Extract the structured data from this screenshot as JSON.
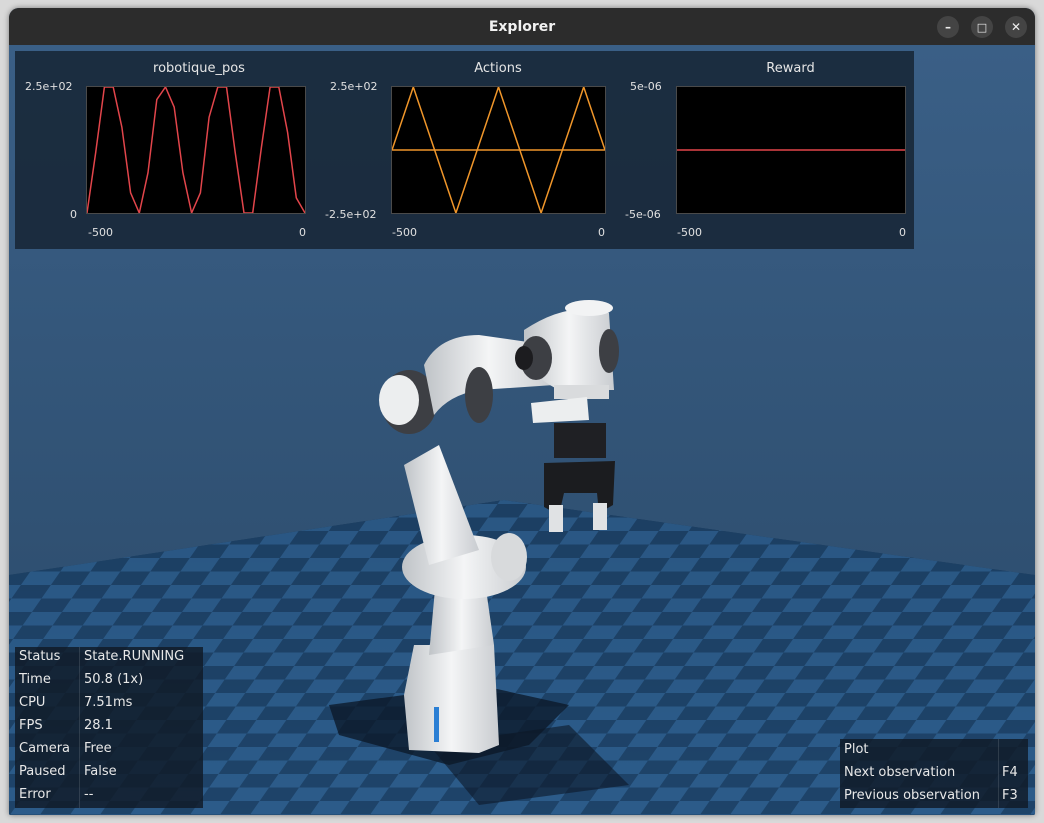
{
  "window": {
    "title": "Explorer",
    "minimize_glyph": "–",
    "maximize_glyph": "□",
    "close_glyph": "✕"
  },
  "plots": [
    {
      "title": "robotique_pos",
      "y_top": "2.5e+02",
      "y_bottom": "0",
      "x_left": "-500",
      "x_right": "0",
      "color": "#e2454b"
    },
    {
      "title": "Actions",
      "y_top": "2.5e+02",
      "y_bottom": "-2.5e+02",
      "x_left": "-500",
      "x_right": "0",
      "color": "#f0962a"
    },
    {
      "title": "Reward",
      "y_top": "5e-06",
      "y_bottom": "-5e-06",
      "x_left": "-500",
      "x_right": "0",
      "color": "#e2454b"
    }
  ],
  "chart_data": [
    {
      "type": "line",
      "title": "robotique_pos",
      "xlim": [
        -500,
        0
      ],
      "ylim": [
        0,
        250
      ],
      "series": [
        {
          "x": [
            -500,
            -480,
            -460,
            -440,
            -420,
            -400,
            -380,
            -360,
            -340,
            -320,
            -300,
            -280,
            -260,
            -240,
            -220,
            -200,
            -180,
            -160,
            -140,
            -120,
            -100,
            -80,
            -60,
            -40,
            -20,
            0
          ],
          "y": [
            0,
            120,
            250,
            250,
            170,
            40,
            0,
            80,
            225,
            250,
            210,
            80,
            0,
            40,
            190,
            250,
            250,
            120,
            0,
            0,
            130,
            250,
            250,
            160,
            30,
            0
          ]
        }
      ]
    },
    {
      "type": "line",
      "title": "Actions",
      "xlim": [
        -500,
        0
      ],
      "ylim": [
        -250,
        250
      ],
      "series": [
        {
          "x": [
            -500,
            -450,
            -400,
            -350,
            -300,
            -250,
            -200,
            -150,
            -100,
            -50,
            0
          ],
          "y": [
            0,
            250,
            0,
            -250,
            0,
            250,
            0,
            -250,
            0,
            250,
            0
          ]
        },
        {
          "x": [
            -500,
            0
          ],
          "y": [
            0,
            0
          ]
        }
      ]
    },
    {
      "type": "line",
      "title": "Reward",
      "xlim": [
        -500,
        0
      ],
      "ylim": [
        -5e-06,
        5e-06
      ],
      "series": [
        {
          "x": [
            -500,
            0
          ],
          "y": [
            0,
            0
          ]
        }
      ]
    }
  ],
  "status": [
    {
      "key": "Status",
      "value": "State.RUNNING"
    },
    {
      "key": "Time",
      "value": "50.8 (1x)"
    },
    {
      "key": "CPU",
      "value": "7.51ms"
    },
    {
      "key": "FPS",
      "value": "28.1"
    },
    {
      "key": "Camera",
      "value": "Free"
    },
    {
      "key": "Paused",
      "value": "False"
    },
    {
      "key": "Error",
      "value": "--"
    }
  ],
  "shortcuts": [
    {
      "label": "Plot",
      "key": ""
    },
    {
      "label": "Next observation",
      "key": "F4"
    },
    {
      "label": "Previous observation",
      "key": "F3"
    }
  ]
}
